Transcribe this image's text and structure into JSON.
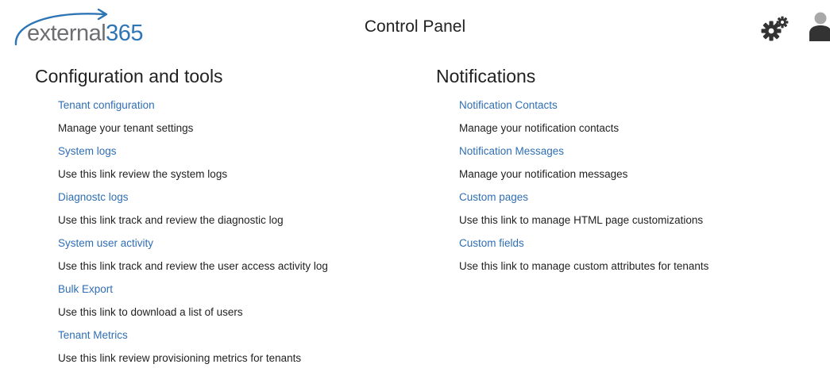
{
  "header": {
    "logo": {
      "word": "external",
      "number": "365"
    },
    "title": "Control Panel",
    "settings_icon": "gears-icon",
    "user_icon": "user-icon"
  },
  "colors": {
    "link": "#2f6eb5",
    "logo_gray": "#6d6e71",
    "logo_blue": "#2e75b6",
    "icon_dark": "#333333",
    "icon_gray": "#a8a8a8"
  },
  "config_tools": {
    "heading": "Configuration and tools",
    "items": [
      {
        "link": "Tenant configuration",
        "description": "Manage your tenant settings"
      },
      {
        "link": "System logs",
        "description": "Use this link review the system logs"
      },
      {
        "link": "Diagnostc logs",
        "description": "Use this link track and review the diagnostic log"
      },
      {
        "link": "System user activity",
        "description": "Use this link track and review the user access activity log"
      },
      {
        "link": "Bulk Export",
        "description": "Use this link to download a list of users"
      },
      {
        "link": "Tenant Metrics",
        "description": "Use this link review provisioning metrics for tenants"
      }
    ]
  },
  "notifications": {
    "heading": "Notifications",
    "items": [
      {
        "link": "Notification Contacts",
        "description": "Manage your notification contacts"
      },
      {
        "link": "Notification Messages",
        "description": "Manage your notification messages"
      },
      {
        "link": "Custom pages",
        "description": "Use this link to manage HTML page customizations"
      },
      {
        "link": "Custom fields",
        "description": "Use this link to manage custom attributes for tenants"
      }
    ]
  }
}
